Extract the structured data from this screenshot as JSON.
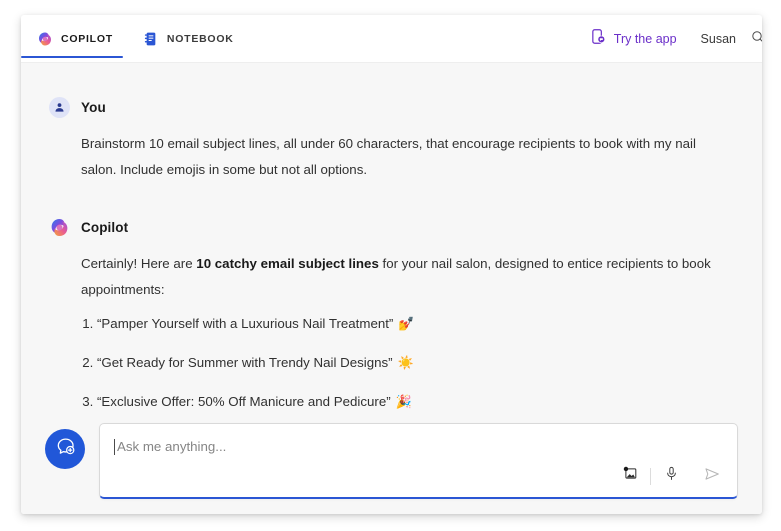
{
  "window": {
    "title": "Microsoft Copilot"
  },
  "header": {
    "tabs": [
      {
        "label": "COPILOT",
        "icon": "copilot-logo-icon",
        "active": true
      },
      {
        "label": "NOTEBOOK",
        "icon": "notebook-icon",
        "active": false
      }
    ],
    "try_app": {
      "label": "Try the app",
      "icon": "mobile-app-icon",
      "color": "#6b2fc9"
    },
    "user": {
      "name": "Susan"
    },
    "search": {
      "icon": "search-icon"
    }
  },
  "conversation": [
    {
      "sender": "You",
      "avatar": "user-avatar-icon",
      "text": "Brainstorm 10 email subject lines, all under 60 characters, that encourage recipients to book with my nail salon. Include emojis in some but not all options."
    },
    {
      "sender": "Copilot",
      "avatar": "copilot-logo-icon",
      "intro_before": "Certainly! Here are ",
      "intro_bold": "10 catchy email subject lines",
      "intro_after": " for your nail salon, designed to entice recipients to book appointments:",
      "answers": [
        {
          "text": "“Pamper Yourself with a Luxurious Nail Treatment”",
          "emoji": "💅"
        },
        {
          "text": "“Get Ready for Summer with Trendy Nail Designs”",
          "emoji": "☀️"
        },
        {
          "text": "“Exclusive Offer: 50% Off Manicure and Pedicure”",
          "emoji": "🎉"
        }
      ]
    }
  ],
  "composer": {
    "new_chat": {
      "icon": "new-chat-icon",
      "color": "#2157d8"
    },
    "input": {
      "value": "",
      "placeholder": "Ask me anything..."
    },
    "tools": [
      {
        "name": "add-image-icon"
      },
      {
        "name": "microphone-icon"
      },
      {
        "name": "send-icon"
      }
    ]
  },
  "colors": {
    "accent_blue": "#2b56d4",
    "accent_purple": "#6b2fc9",
    "window_bg": "#f7f7f7"
  }
}
